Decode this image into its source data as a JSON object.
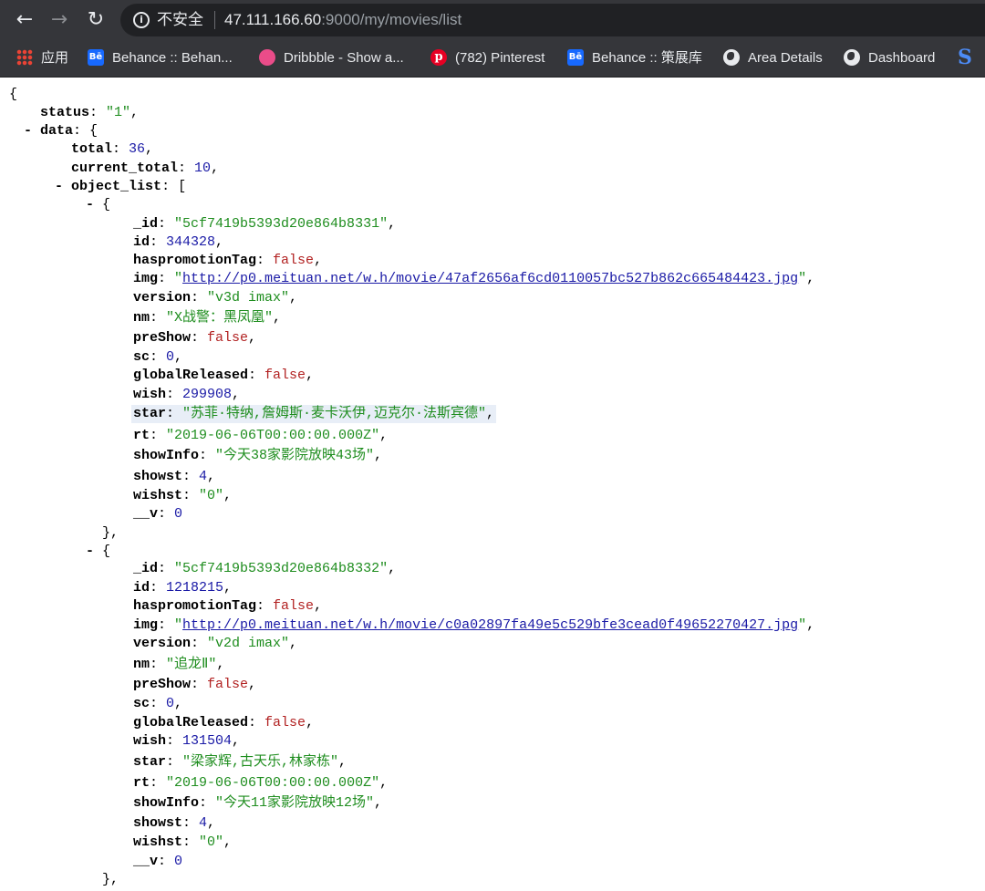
{
  "browser": {
    "insecure_label": "不安全",
    "url_host": "47.111.166.60",
    "url_rest": ":9000/my/movies/list",
    "bookmarks": [
      {
        "label": "应用",
        "icon": "apps-grid-icon"
      },
      {
        "label": "Behance :: Behan...",
        "icon": "behance-icon"
      },
      {
        "label": "Dribbble - Show a...",
        "icon": "dribbble-icon"
      },
      {
        "label": "(782) Pinterest",
        "icon": "pinterest-icon"
      },
      {
        "label": "Behance :: 策展库",
        "icon": "behance-icon"
      },
      {
        "label": "Area Details",
        "icon": "globe-icon"
      },
      {
        "label": "Dashboard",
        "icon": "globe-icon"
      },
      {
        "label": "S",
        "icon": "s-logo-icon"
      }
    ]
  },
  "json": {
    "status": "\"1\"",
    "total": "36",
    "current_total": "10",
    "objects": [
      {
        "_id": "\"5cf7419b5393d20e864b8331\"",
        "id": "344328",
        "haspromotionTag": "false",
        "img": "http://p0.meituan.net/w.h/movie/47af2656af6cd0110057bc527b862c665484423.jpg",
        "version": "\"v3d imax\"",
        "nm": "\"X战警：黑凤凰\"",
        "preShow": "false",
        "sc": "0",
        "globalReleased": "false",
        "wish": "299908",
        "star": "\"苏菲·特纳,詹姆斯·麦卡沃伊,迈克尔·法斯宾德\"",
        "rt": "\"2019-06-06T00:00:00.000Z\"",
        "showInfo": "\"今天38家影院放映43场\"",
        "showst": "4",
        "wishst": "\"0\"",
        "__v": "0"
      },
      {
        "_id": "\"5cf7419b5393d20e864b8332\"",
        "id": "1218215",
        "haspromotionTag": "false",
        "img": "http://p0.meituan.net/w.h/movie/c0a02897fa49e5c529bfe3cead0f49652270427.jpg",
        "version": "\"v2d imax\"",
        "nm": "\"追龙Ⅱ\"",
        "preShow": "false",
        "sc": "0",
        "globalReleased": "false",
        "wish": "131504",
        "star": "\"梁家辉,古天乐,林家栋\"",
        "rt": "\"2019-06-06T00:00:00.000Z\"",
        "showInfo": "\"今天11家影院放映12场\"",
        "showst": "4",
        "wishst": "\"0\"",
        "__v": "0"
      }
    ]
  }
}
